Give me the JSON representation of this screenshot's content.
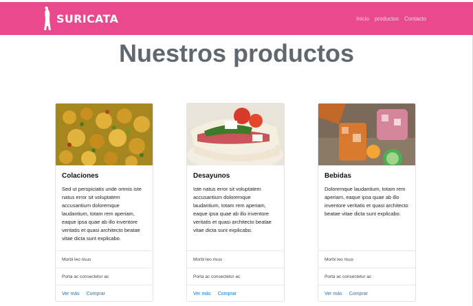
{
  "navbar": {
    "brand": "SURICATA",
    "links": [
      "Inicio",
      "productos",
      "Contacto"
    ],
    "color": "#e94a8e"
  },
  "page_title": "Nuestros productos",
  "cards": [
    {
      "title": "Colaciones",
      "text": "Sed ut perspiciatis unde omnis iste natus error sit voluptatem accusantium doloremque laudantium, totam rem aperiam, eaque ipsa quae ab illo inventore veritatis et quasi architecto beatae vitae dicta sunt explicabo.",
      "items": [
        "Morbi leo risus",
        "Porta ac consectetur ac"
      ],
      "link1": "Ver más",
      "link2": "Comprar"
    },
    {
      "title": "Desayunos",
      "text": "Iste natus error sit voluptatem accusantium doloremque laudantium, totam rem aperiam, eaque ipsa quae ab illo inventore veritatis et quasi architecto beatae vitae dicta sunt explicabo.",
      "items": [
        "Morbi leo risus",
        "Porta ac consectetur ac"
      ],
      "link1": "Ver más",
      "link2": "Comprar"
    },
    {
      "title": "Bebidas",
      "text": "Doloremque laudantium, totam rem aperiam, eaque ipsa quae ab illo inventore veritatis et quasi architecto beatae vitae dicta sunt explicabo.",
      "items": [
        "Morbi leo risus",
        "Porta ac consectetur ac"
      ],
      "link1": "Ver más",
      "link2": "Comprar"
    }
  ]
}
